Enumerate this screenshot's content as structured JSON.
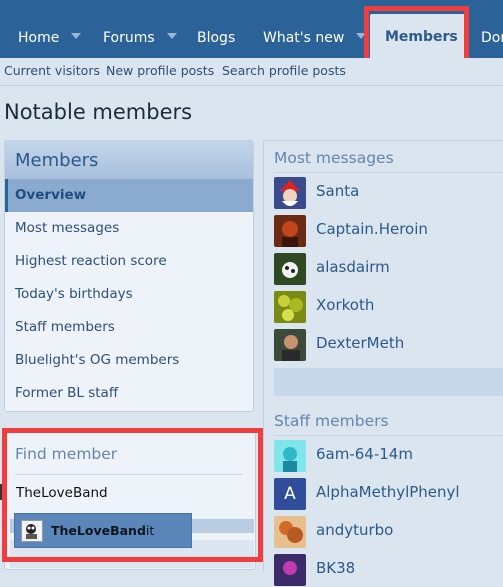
{
  "nav": {
    "items": [
      {
        "label": "Home",
        "has_menu": true
      },
      {
        "label": "Forums",
        "has_menu": true
      },
      {
        "label": "Blogs",
        "has_menu": false
      },
      {
        "label": "What's new",
        "has_menu": true
      },
      {
        "label": "Members",
        "active": true
      },
      {
        "label": "Dor"
      }
    ]
  },
  "subnav": {
    "items": [
      "Current visitors",
      "New profile posts",
      "Search profile posts"
    ]
  },
  "page_title": "Notable members",
  "members_block": {
    "title": "Members",
    "items": [
      "Overview",
      "Most messages",
      "Highest reaction score",
      "Today's birthdays",
      "Staff members",
      "Bluelight's OG members",
      "Former BL staff"
    ],
    "active_index": 0
  },
  "find_member": {
    "title": "Find member",
    "input_value": "TheLoveBand",
    "suggestion": {
      "match": "TheLoveBand",
      "rest": "it"
    }
  },
  "most_messages": {
    "title": "Most messages",
    "members": [
      "Santa",
      "Captain.Heroin",
      "alasdairm",
      "Xorkoth",
      "DexterMeth"
    ]
  },
  "staff_members": {
    "title": "Staff members",
    "members": [
      "6am-64-14m",
      "AlphaMethylPhenyl",
      "andyturbo",
      "BK38"
    ],
    "letter_avatar": "A"
  },
  "colors": {
    "nav_bg": "#2b6398",
    "page_bg": "#dbe5f0",
    "highlight": "#f03d3d",
    "link": "#2b5a8a",
    "suggestion_bg": "#5b86b9"
  }
}
